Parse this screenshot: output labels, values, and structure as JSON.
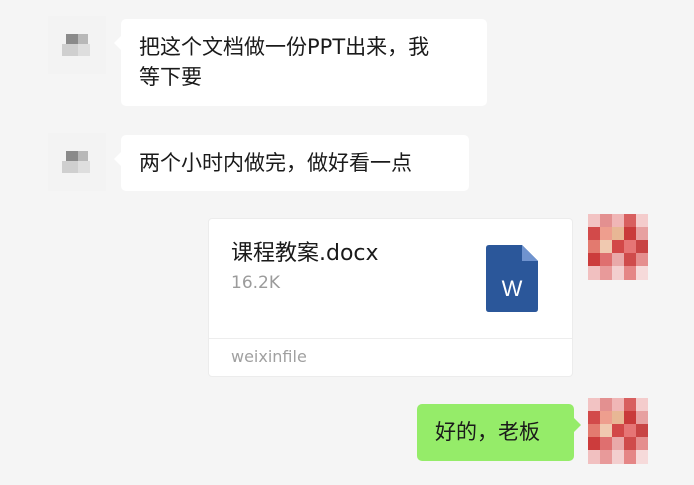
{
  "messages": [
    {
      "side": "left",
      "text": "把这个文档做一份PPT出来，我\n等下要"
    },
    {
      "side": "left",
      "text": "两个小时内做完，做好看一点"
    },
    {
      "side": "right",
      "type": "file",
      "file": {
        "name": "课程教案.docx",
        "size": "16.2K",
        "source": "weixinfile",
        "icon": "word-doc-icon",
        "icon_letter": "W",
        "icon_color": "#2b579a"
      }
    },
    {
      "side": "right",
      "text": "好的，老板"
    }
  ],
  "colors": {
    "background": "#f5f5f5",
    "left_bubble": "#ffffff",
    "right_bubble": "#95ec69",
    "word_blue": "#2b579a"
  }
}
